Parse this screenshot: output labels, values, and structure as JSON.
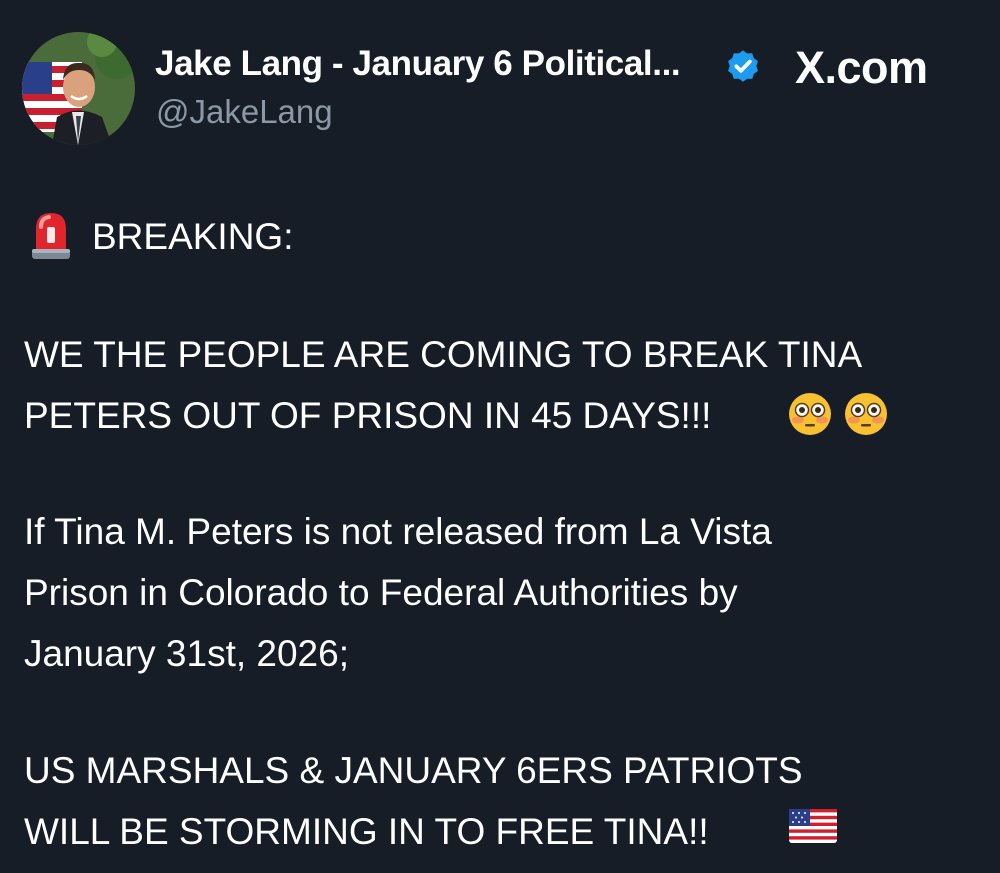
{
  "post": {
    "author_name": "Jake Lang - January 6 Political...",
    "handle": "@JakeLang",
    "brand": "X.com",
    "lines": {
      "breaking": "BREAKING:",
      "p1_line1": "WE THE PEOPLE ARE COMING TO BREAK TINA",
      "p1_line2": "PETERS OUT OF PRISON IN 45 DAYS!!!",
      "p2_line1": "If Tina M. Peters is not released from La Vista",
      "p2_line2": "Prison in Colorado to Federal Authorities by",
      "p2_line3": "January 31st, 2026;",
      "p3_line1": "US MARSHALS & JANUARY 6ERS PATRIOTS",
      "p3_line2": "WILL BE STORMING IN TO FREE TINA!!"
    },
    "icons": {
      "verified": "verified-badge-icon",
      "siren": "police-siren-emoji",
      "flushed": "flushed-face-emoji",
      "flag": "us-flag-emoji"
    }
  },
  "colors": {
    "background": "#161d27",
    "text": "#ffffff",
    "secondary_text": "#8b98a5",
    "verified_blue": "#1d9bf0"
  }
}
